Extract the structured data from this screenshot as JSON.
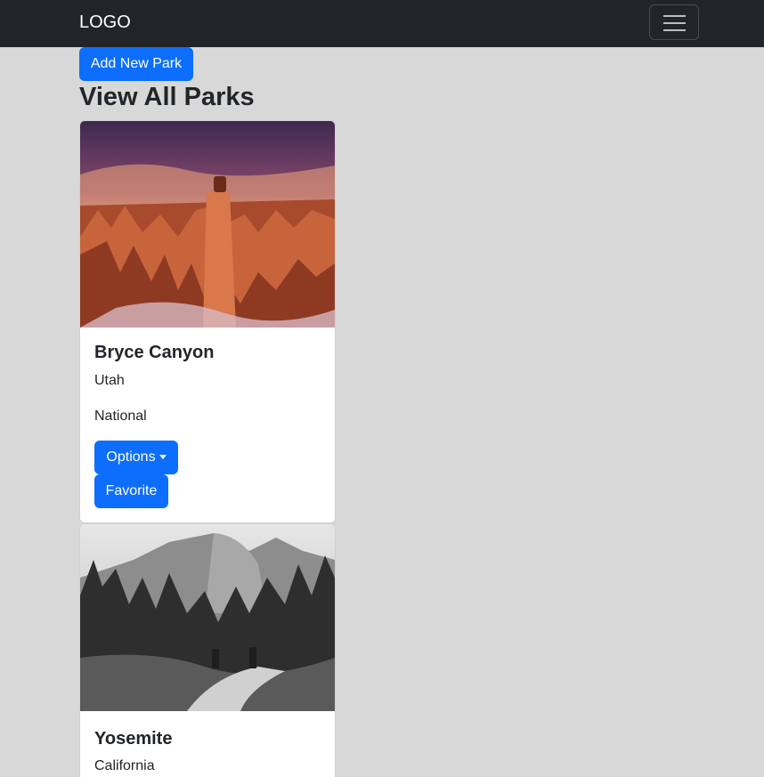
{
  "navbar": {
    "brand": "LOGO",
    "toggler_icon": "hamburger-icon"
  },
  "actions": {
    "add_label": "Add New Park"
  },
  "page": {
    "title": "View All Parks"
  },
  "colors": {
    "primary": "#0d6efd",
    "navbar": "#212529",
    "background": "#d8d8d8"
  },
  "parks": [
    {
      "name": "Bryce Canyon",
      "location": "Utah",
      "type": "National",
      "image": "bryce-canyon-photo",
      "options_label": "Options",
      "favorite_label": "Favorite"
    },
    {
      "name": "Yosemite",
      "location": "California",
      "image": "yosemite-photo"
    }
  ]
}
